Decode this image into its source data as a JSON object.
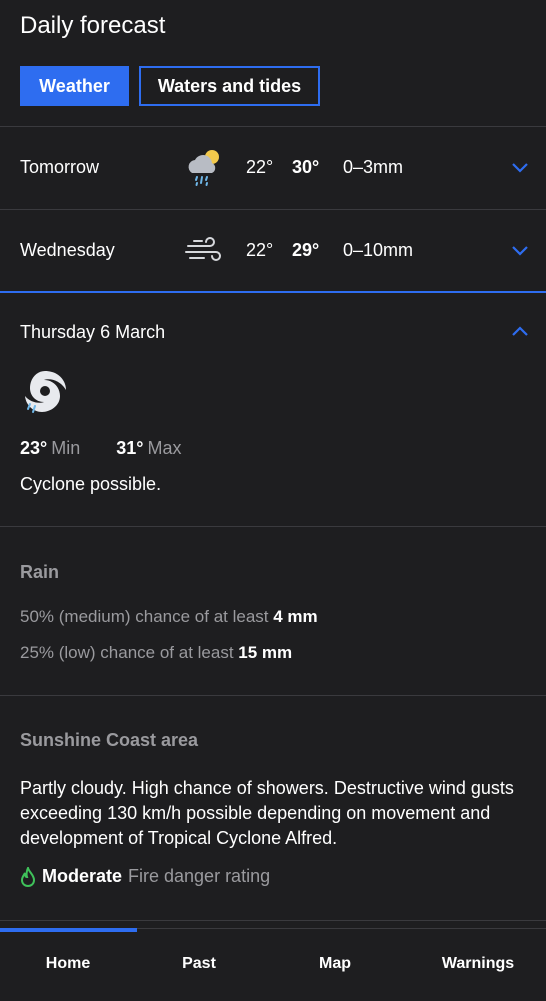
{
  "page_title": "Daily forecast",
  "tabs": [
    {
      "label": "Weather",
      "active": true
    },
    {
      "label": "Waters and tides",
      "active": false
    }
  ],
  "days": [
    {
      "name": "Tomorrow",
      "icon": "showers-sun-icon",
      "min": "22°",
      "max": "30°",
      "rain": "0–3mm"
    },
    {
      "name": "Wednesday",
      "icon": "wind-icon",
      "min": "22°",
      "max": "29°",
      "rain": "0–10mm"
    }
  ],
  "expanded": {
    "day": "Thursday",
    "date": "6 March",
    "icon": "cyclone-icon",
    "min": "23°",
    "min_label": "Min",
    "max": "31°",
    "max_label": "Max",
    "summary": "Cyclone possible.",
    "rain_heading": "Rain",
    "rain_lines": [
      {
        "text": "50% (medium) chance of at least",
        "amount": "4 mm"
      },
      {
        "text": "25% (low) chance of at least",
        "amount": "15 mm"
      }
    ],
    "area_heading": "Sunshine Coast area",
    "area_text": "Partly cloudy. High chance of showers. Destructive wind gusts exceeding 130 km/h possible depending on movement and development of Tropical Cyclone Alfred.",
    "fire_rating": "Moderate",
    "fire_label": "Fire danger rating"
  },
  "nav": [
    {
      "label": "Home",
      "active": true
    },
    {
      "label": "Past"
    },
    {
      "label": "Map"
    },
    {
      "label": "Warnings"
    }
  ],
  "colors": {
    "accent": "#2e6df0",
    "fire_green": "#3fc15a",
    "background": "#1e1e20"
  }
}
